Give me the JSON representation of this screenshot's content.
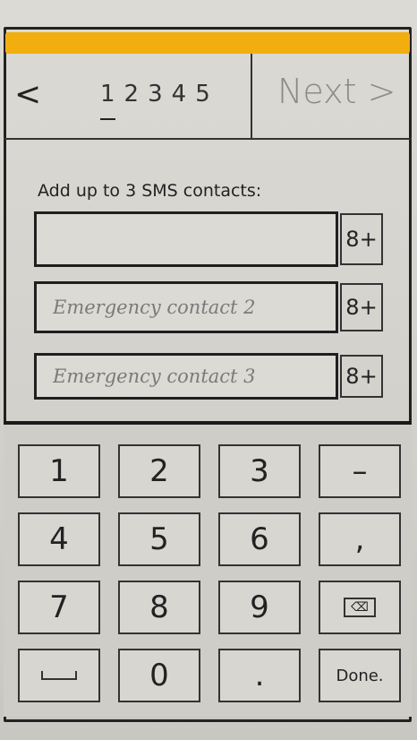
{
  "header": {
    "back_glyph": "<",
    "pages": [
      "1",
      "2",
      "3",
      "4",
      "5"
    ],
    "current_page": "1",
    "next_label": "Next >"
  },
  "form": {
    "title": "Add up to 3 SMS contacts:",
    "fields": [
      {
        "value": "",
        "placeholder": ""
      },
      {
        "value": "",
        "placeholder": "Emergency contact 2"
      },
      {
        "value": "",
        "placeholder": "Emergency contact 3"
      }
    ],
    "contact_button_label": "8+"
  },
  "keyboard": {
    "keys": [
      "1",
      "2",
      "3",
      "–",
      "4",
      "5",
      "6",
      ",",
      "7",
      "8",
      "9",
      "⌫",
      "␣",
      "0",
      ".",
      "Done."
    ]
  },
  "colors": {
    "status_bar": "#f2ae0f",
    "next_disabled": "#8b8b8b"
  }
}
